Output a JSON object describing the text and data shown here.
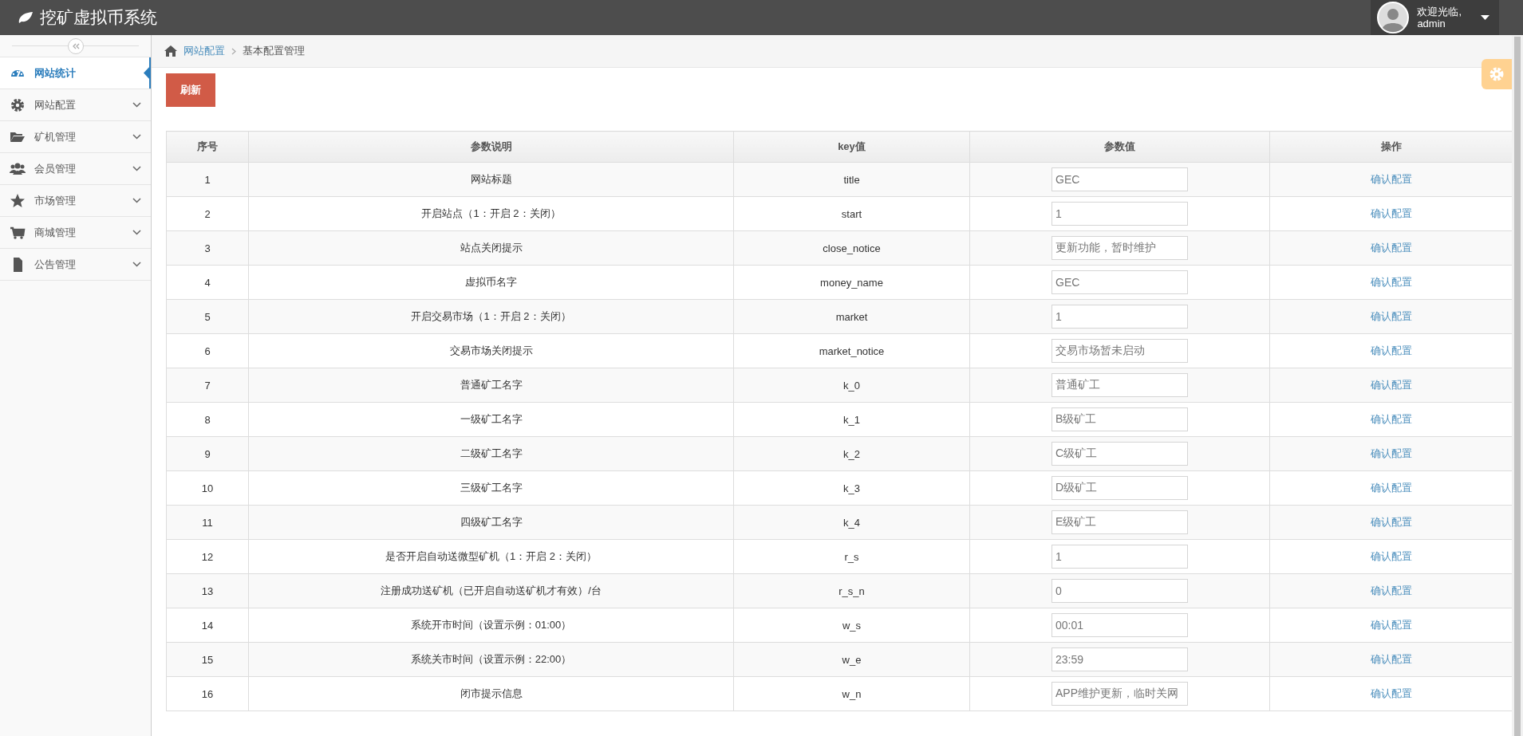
{
  "header": {
    "title": "挖矿虚拟币系统",
    "greeting": "欢迎光临,",
    "username": "admin"
  },
  "sidebar": {
    "items": [
      {
        "label": "网站统计",
        "selected": true,
        "expandable": false
      },
      {
        "label": "网站配置",
        "selected": false,
        "expandable": true
      },
      {
        "label": "矿机管理",
        "selected": false,
        "expandable": true
      },
      {
        "label": "会员管理",
        "selected": false,
        "expandable": true
      },
      {
        "label": "市场管理",
        "selected": false,
        "expandable": true
      },
      {
        "label": "商城管理",
        "selected": false,
        "expandable": true
      },
      {
        "label": "公告管理",
        "selected": false,
        "expandable": true
      }
    ]
  },
  "breadcrumb": [
    {
      "label": "网站配置",
      "link": true
    },
    {
      "label": "基本配置管理",
      "link": false
    }
  ],
  "refresh_button": "刷新",
  "table": {
    "columns": [
      "序号",
      "参数说明",
      "key值",
      "参数值",
      "操作"
    ],
    "rows": [
      {
        "no": "1",
        "description": "网站标题",
        "key": "title",
        "value": "GEC",
        "action": "确认配置"
      },
      {
        "no": "2",
        "description": "开启站点（1：开启 2：关闭）",
        "key": "start",
        "value": "1",
        "action": "确认配置"
      },
      {
        "no": "3",
        "description": "站点关闭提示",
        "key": "close_notice",
        "value": "更新功能，暂时维护",
        "action": "确认配置"
      },
      {
        "no": "4",
        "description": "虚拟币名字",
        "key": "money_name",
        "value": "GEC",
        "action": "确认配置"
      },
      {
        "no": "5",
        "description": "开启交易市场（1：开启 2：关闭）",
        "key": "market",
        "value": "1",
        "action": "确认配置"
      },
      {
        "no": "6",
        "description": "交易市场关闭提示",
        "key": "market_notice",
        "value": "交易市场暂未启动",
        "action": "确认配置"
      },
      {
        "no": "7",
        "description": "普通矿工名字",
        "key": "k_0",
        "value": "普通矿工",
        "action": "确认配置"
      },
      {
        "no": "8",
        "description": "一级矿工名字",
        "key": "k_1",
        "value": "B级矿工",
        "action": "确认配置"
      },
      {
        "no": "9",
        "description": "二级矿工名字",
        "key": "k_2",
        "value": "C级矿工",
        "action": "确认配置"
      },
      {
        "no": "10",
        "description": "三级矿工名字",
        "key": "k_3",
        "value": "D级矿工",
        "action": "确认配置"
      },
      {
        "no": "11",
        "description": "四级矿工名字",
        "key": "k_4",
        "value": "E级矿工",
        "action": "确认配置"
      },
      {
        "no": "12",
        "description": "是否开启自动送微型矿机（1：开启 2：关闭）",
        "key": "r_s",
        "value": "1",
        "action": "确认配置"
      },
      {
        "no": "13",
        "description": "注册成功送矿机（已开启自动送矿机才有效）/台",
        "key": "r_s_n",
        "value": "0",
        "action": "确认配置"
      },
      {
        "no": "14",
        "description": "系统开市时间（设置示例：01:00）",
        "key": "w_s",
        "value": "00:01",
        "action": "确认配置"
      },
      {
        "no": "15",
        "description": "系统关市时间（设置示例：22:00）",
        "key": "w_e",
        "value": "23:59",
        "action": "确认配置"
      },
      {
        "no": "16",
        "description": "闭市提示信息",
        "key": "w_n",
        "value": "APP维护更新，临时关网",
        "action": "确认配置"
      }
    ]
  }
}
